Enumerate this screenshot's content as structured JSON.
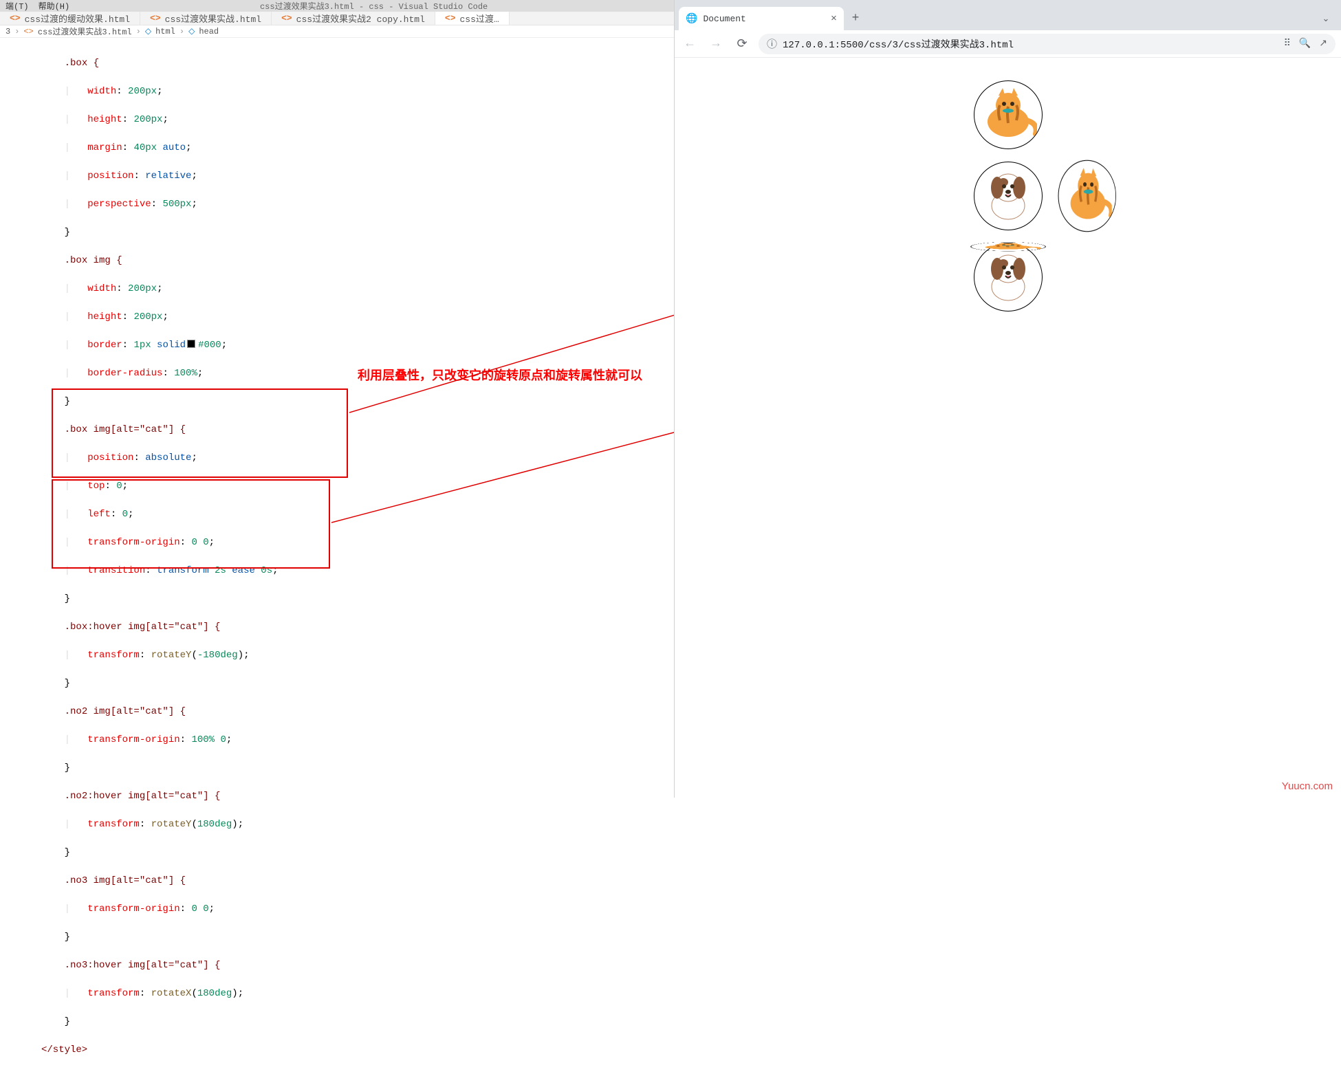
{
  "vscode": {
    "menu": {
      "terminal": "端(T)",
      "help": "帮助(H)"
    },
    "title_center": "css过渡效果实战3.html - css - Visual Studio Code",
    "tabs": [
      {
        "label": "css过渡的缓动效果.html"
      },
      {
        "label": "css过渡效果实战.html"
      },
      {
        "label": "css过渡效果实战2 copy.html"
      },
      {
        "label": "css过渡…"
      }
    ],
    "breadcrumb": {
      "a": "3",
      "b": "css过渡效果实战3.html",
      "c": "html",
      "d": "head"
    },
    "annotation": "利用层叠性，只改变它的旋转原点和旋转属性就可以"
  },
  "code": {
    "l1": ".box {",
    "l2_prop": "width",
    "l2_val": " 200px",
    "l3_prop": "height",
    "l3_val": " 200px",
    "l4_prop": "margin",
    "l4_val1": " 40px",
    "l4_val2": " auto",
    "l5_prop": "position",
    "l5_val": " relative",
    "l6_prop": "perspective",
    "l6_val": " 500px",
    "l7": "}",
    "l8": ".box img {",
    "l9_prop": "width",
    "l9_val": " 200px",
    "l10_prop": "height",
    "l10_val": " 200px",
    "l11_prop": "border",
    "l11_v1": " 1px",
    "l11_v2": " solid",
    "l11_v3": "#000",
    "l12_prop": "border-radius",
    "l12_val": " 100%",
    "l13": "}",
    "l14": ".box img[alt=\"cat\"] {",
    "l15_prop": "position",
    "l15_val": " absolute",
    "l16_prop": "top",
    "l16_val": " 0",
    "l17_prop": "left",
    "l17_val": " 0",
    "l18_prop": "transform-origin",
    "l18_v1": " 0",
    "l18_v2": " 0",
    "l19_prop": "transition",
    "l19_v1": " transform",
    "l19_v2": " 2s",
    "l19_v3": " ease",
    "l19_v4": " 0s",
    "l20": "}",
    "l21": ".box:hover img[alt=\"cat\"] {",
    "l22_prop": "transform",
    "l22_fn": " rotateY",
    "l22_arg": "-180deg",
    "l23": "}",
    "l24": ".no2 img[alt=\"cat\"] {",
    "l25_prop": "transform-origin",
    "l25_v1": " 100%",
    "l25_v2": " 0",
    "l26": "}",
    "l27": ".no2:hover img[alt=\"cat\"] {",
    "l28_prop": "transform",
    "l28_fn": " rotateY",
    "l28_arg": "180deg",
    "l29": "}",
    "l30": ".no3 img[alt=\"cat\"] {",
    "l31_prop": "transform-origin",
    "l31_v1": " 0",
    "l31_v2": " 0",
    "l32": "}",
    "l33": ".no3:hover img[alt=\"cat\"] {",
    "l34_prop": "transform",
    "l34_fn": " rotateX",
    "l34_arg": "180deg",
    "l35": "}",
    "l36": "</style>"
  },
  "browser": {
    "tab_title": "Document",
    "url": "127.0.0.1:5500/css/3/css过渡效果实战3.html",
    "watermark": "Yuucn.com"
  }
}
